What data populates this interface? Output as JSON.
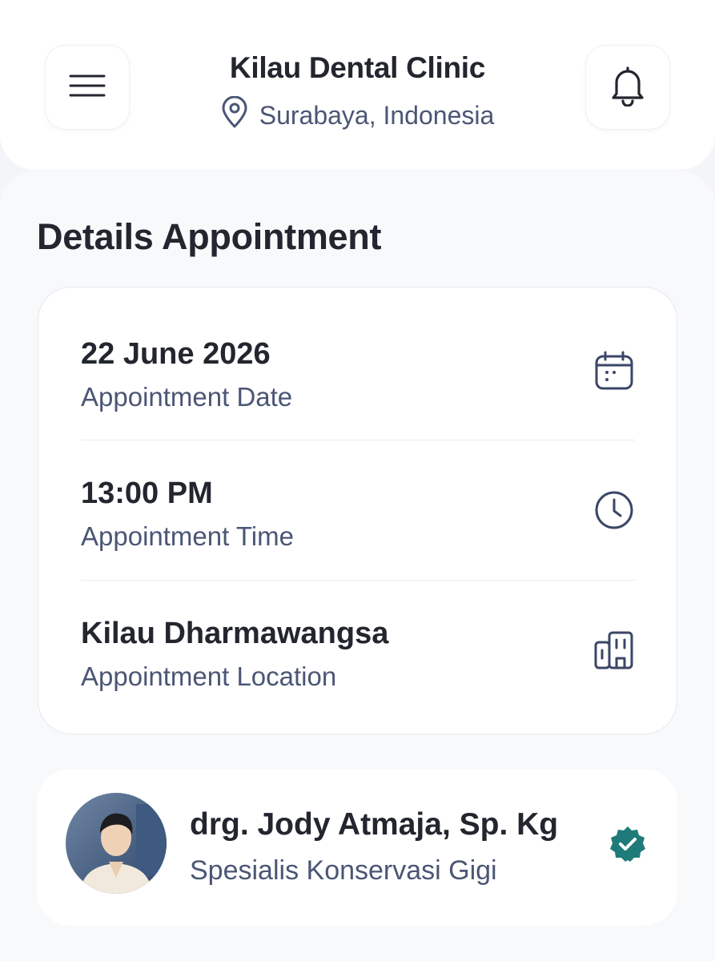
{
  "header": {
    "clinic_name": "Kilau Dental Clinic",
    "location": "Surabaya, Indonesia",
    "menu_icon": "hamburger-menu-icon",
    "notification_icon": "bell-icon",
    "location_icon": "map-pin-icon"
  },
  "section": {
    "title": "Details Appointment"
  },
  "details": [
    {
      "value": "22 June 2026",
      "label": "Appointment Date",
      "icon": "calendar-icon"
    },
    {
      "value": "13:00 PM",
      "label": "Appointment Time",
      "icon": "clock-icon"
    },
    {
      "value": "Kilau Dharmawangsa",
      "label": "Appointment Location",
      "icon": "building-icon"
    }
  ],
  "doctor": {
    "name": "drg. Jody Atmaja, Sp. Kg",
    "specialty": "Spesialis Konservasi Gigi",
    "badge_icon": "verified-badge-icon",
    "badge_color": "#1f7b7a"
  },
  "colors": {
    "primary_text": "#23262f",
    "secondary_text": "#4b5675",
    "background": "#f8f9fb",
    "card": "#ffffff"
  }
}
